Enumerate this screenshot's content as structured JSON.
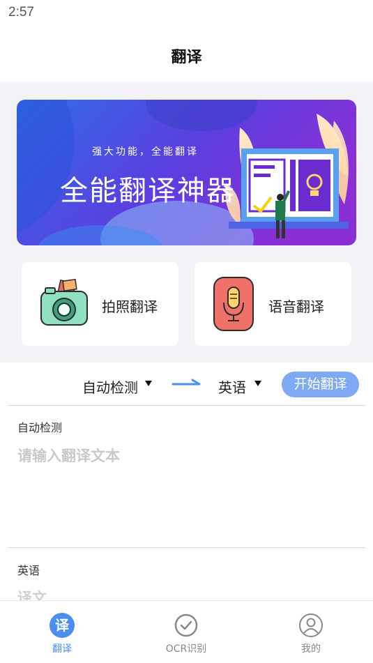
{
  "status_bar": {
    "time": "2:57"
  },
  "header": {
    "title": "翻译"
  },
  "banner": {
    "subtitle": "强大功能，全能翻译",
    "title": "全能翻译神器"
  },
  "features": [
    {
      "label": "拍照翻译",
      "icon": "camera-icon"
    },
    {
      "label": "语音翻译",
      "icon": "microphone-icon"
    }
  ],
  "language_bar": {
    "source_language": "自动检测",
    "target_language": "英语",
    "start_button": "开始翻译"
  },
  "source_panel": {
    "label": "自动检测",
    "placeholder": "请输入翻译文本"
  },
  "target_panel": {
    "label": "英语",
    "placeholder": "译文"
  },
  "tabs": [
    {
      "label": "翻译",
      "badge": "译",
      "icon": "translate-icon",
      "active": true
    },
    {
      "label": "OCR识别",
      "icon": "check-circle-icon",
      "active": false
    },
    {
      "label": "我的",
      "icon": "user-icon",
      "active": false
    }
  ],
  "colors": {
    "accent": "#4a8ff0",
    "start_button": "#7eaaf3",
    "banner_gradient_start": "#2f7be8",
    "banner_gradient_end": "#7b2fd8",
    "background_gray": "#f2f2f7"
  }
}
